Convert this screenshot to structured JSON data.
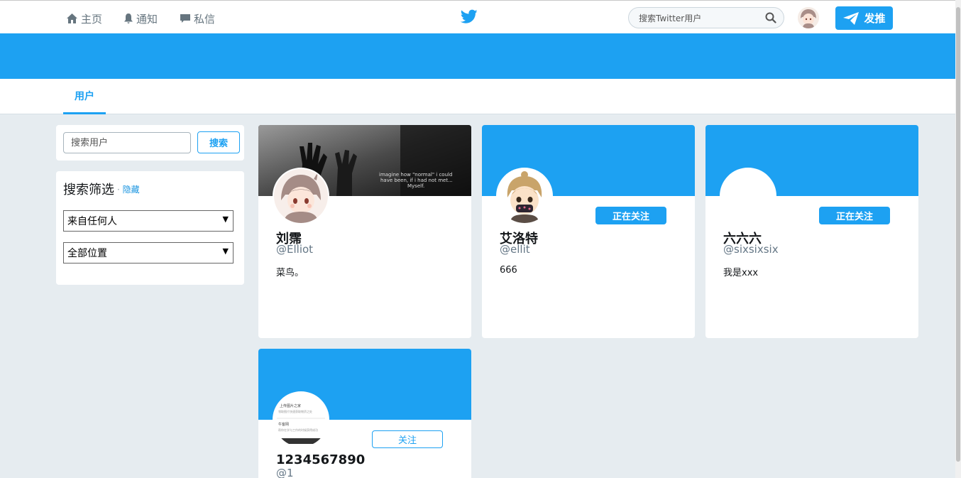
{
  "nav": {
    "home": "主页",
    "notifications": "通知",
    "messages": "私信",
    "search_placeholder": "搜索Twitter用户",
    "tweet_button": "发推"
  },
  "tabs": {
    "users": "用户"
  },
  "sidebar": {
    "search_placeholder": "搜索用户",
    "search_button": "搜索",
    "filter_title": "搜索筛选",
    "filter_hide": "隐藏",
    "filter_separator": "·",
    "people_select": "来自任何人",
    "location_select": "全部位置"
  },
  "cards": [
    {
      "name": "刘霈",
      "handle": "@Elliot",
      "bio": "菜鸟。",
      "follow_label": ""
    },
    {
      "name": "艾洛特",
      "handle": "@ellit",
      "bio": "666",
      "follow_label": "正在关注"
    },
    {
      "name": "六六六",
      "handle": "@sixsixsix",
      "bio": "我是xxx",
      "follow_label": "正在关注"
    },
    {
      "name": "1234567890",
      "handle": "@1",
      "bio": "",
      "follow_label": "关注"
    }
  ],
  "cover_image_text": {
    "line1": "imagine how \"normal\" i could",
    "line2": "have been, if i had not met...",
    "line3": "Myself."
  },
  "avatar4_text": {
    "line1": "上传图片之家",
    "line2": "领取图片快速获取物资之处",
    "line3": "牛客网",
    "line4": "帮你在学与工作的时候获得成功"
  },
  "colors": {
    "accent": "#1da1f2",
    "page_bg": "#e6ecf0"
  }
}
